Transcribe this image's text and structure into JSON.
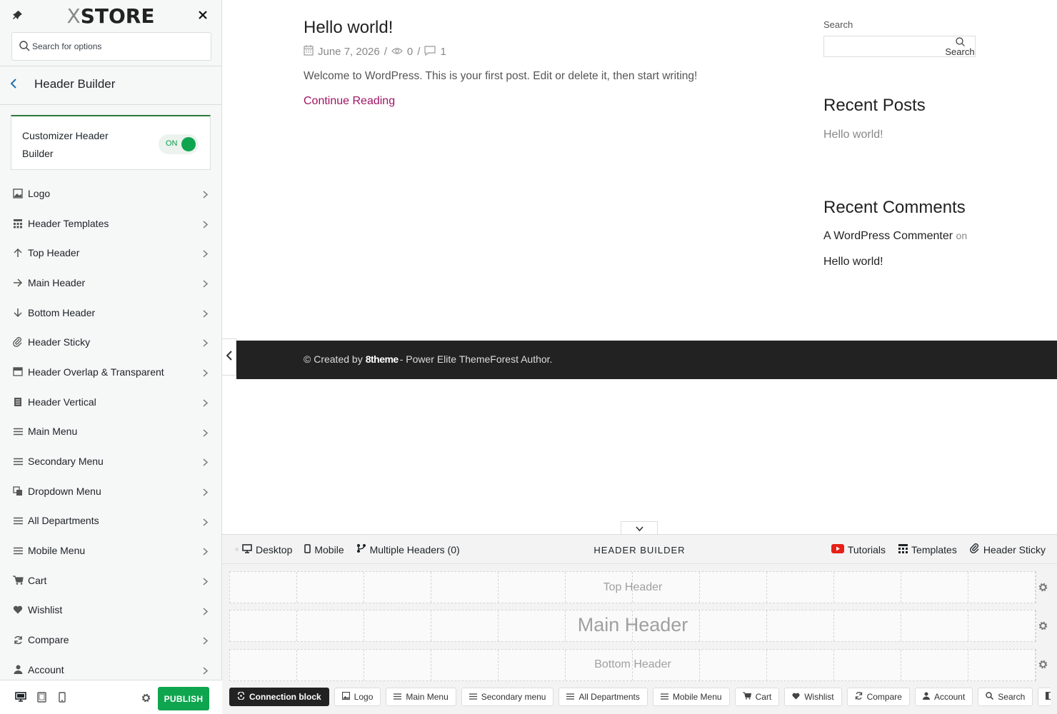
{
  "sidebar": {
    "logo": {
      "prefix": "X",
      "name": "STORE"
    },
    "search": {
      "placeholder": "Search for options"
    },
    "section_title": "Header Builder",
    "toggle_card": {
      "label": "Customizer Header Builder",
      "state": "ON"
    },
    "items": [
      {
        "label": "Logo",
        "icon": "image-icon"
      },
      {
        "label": "Header Templates",
        "icon": "templates-icon"
      },
      {
        "label": "Top Header",
        "icon": "arrow-up-icon"
      },
      {
        "label": "Main Header",
        "icon": "arrow-right-icon"
      },
      {
        "label": "Bottom Header",
        "icon": "arrow-down-icon"
      },
      {
        "label": "Header Sticky",
        "icon": "paperclip-icon"
      },
      {
        "label": "Header Overlap & Transparent",
        "icon": "overlap-icon"
      },
      {
        "label": "Header Vertical",
        "icon": "page-icon"
      },
      {
        "label": "Main Menu",
        "icon": "menu-icon"
      },
      {
        "label": "Secondary Menu",
        "icon": "menu-icon"
      },
      {
        "label": "Dropdown Menu",
        "icon": "dropdown-icon"
      },
      {
        "label": "All Departments",
        "icon": "menu-icon"
      },
      {
        "label": "Mobile Menu",
        "icon": "menu-icon"
      },
      {
        "label": "Cart",
        "icon": "cart-icon"
      },
      {
        "label": "Wishlist",
        "icon": "heart-icon"
      },
      {
        "label": "Compare",
        "icon": "refresh-icon"
      },
      {
        "label": "Account",
        "icon": "user-icon"
      }
    ],
    "footer": {
      "publish_label": "PUBLISH"
    }
  },
  "preview": {
    "post": {
      "title": "Hello world!",
      "date": "June 7, 2026",
      "views": "0",
      "comments": "1",
      "excerpt": "Welcome to WordPress. This is your first post. Edit or delete it, then start writing!",
      "read_more": "Continue Reading"
    },
    "widgets": {
      "search_label": "Search",
      "search_button": "Search",
      "recent_posts_title": "Recent Posts",
      "recent_post_1": "Hello world!",
      "recent_comments_title": "Recent Comments",
      "commenter": "A WordPress Commenter",
      "on_word": "on",
      "comment_post": "Hello world!"
    },
    "footer": {
      "prefix": "© Created by",
      "brand": "8theme",
      "suffix": "- Power Elite ThemeForest Author."
    }
  },
  "header_builder": {
    "title": "HEADER BUILDER",
    "tabs": [
      {
        "label": "Desktop",
        "icon": "desktop-icon"
      },
      {
        "label": "Mobile",
        "icon": "mobile-icon"
      },
      {
        "label": "Multiple Headers (0)",
        "icon": "branch-icon"
      }
    ],
    "right_links": [
      {
        "label": "Tutorials",
        "icon": "youtube-icon"
      },
      {
        "label": "Templates",
        "icon": "templates-icon"
      },
      {
        "label": "Header Sticky",
        "icon": "paperclip-icon"
      }
    ],
    "rows": {
      "top": "Top Header",
      "main": "Main Header",
      "bottom": "Bottom Header"
    },
    "chips": [
      {
        "label": "Connection block",
        "icon": "connection-icon"
      },
      {
        "label": "Logo",
        "icon": "image-icon"
      },
      {
        "label": "Main Menu",
        "icon": "menu-icon"
      },
      {
        "label": "Secondary menu",
        "icon": "menu-icon"
      },
      {
        "label": "All Departments",
        "icon": "menu-icon"
      },
      {
        "label": "Mobile Menu",
        "icon": "menu-icon"
      },
      {
        "label": "Cart",
        "icon": "cart-icon"
      },
      {
        "label": "Wishlist",
        "icon": "heart-icon"
      },
      {
        "label": "Compare",
        "icon": "refresh-icon"
      },
      {
        "label": "Account",
        "icon": "user-icon"
      },
      {
        "label": "Search",
        "icon": "search-icon"
      },
      {
        "label": "",
        "icon": "overlap-icon"
      }
    ]
  },
  "colors": {
    "accent_green": "#0fa54f",
    "link_magenta": "#a01463",
    "wp_blue": "#2271b1",
    "footer_dark": "#222222"
  }
}
